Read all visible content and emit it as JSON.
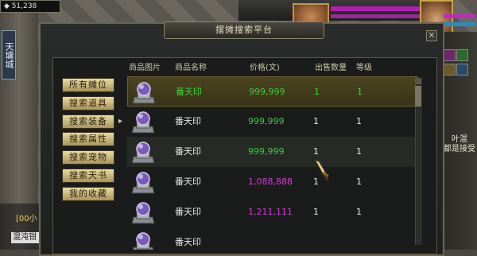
{
  "hud": {
    "gold": "51,238",
    "city": "天墉城"
  },
  "dialog": {
    "title": "摆摊搜索平台",
    "close": "×"
  },
  "side_buttons": [
    {
      "label": "所有摊位"
    },
    {
      "label": "搜索道具"
    },
    {
      "label": "搜索装备"
    },
    {
      "label": "搜索属性"
    },
    {
      "label": "搜索宠物"
    },
    {
      "label": "搜索天书"
    },
    {
      "label": "我的收藏"
    }
  ],
  "side_arrow": "▸",
  "table": {
    "columns": [
      "商品图片",
      "商品名称",
      "价格(文)",
      "出售数量",
      "等级"
    ],
    "rows": [
      {
        "name": "番天印",
        "price": "999,999",
        "qty": "1",
        "level": "1",
        "state": "selected"
      },
      {
        "name": "番天印",
        "price": "999,999",
        "qty": "1",
        "level": "1",
        "state": "normal"
      },
      {
        "name": "番天印",
        "price": "999,999",
        "qty": "1",
        "level": "1",
        "state": "alt"
      },
      {
        "name": "番天印",
        "price": "1,088,888",
        "qty": "1",
        "level": "1",
        "state": "normal"
      },
      {
        "name": "番天印",
        "price": "1,211,111",
        "qty": "1",
        "level": "1",
        "state": "normal"
      },
      {
        "name": "番天印",
        "price": "",
        "qty": "",
        "level": "",
        "state": "normal"
      }
    ]
  },
  "colors": {
    "selected_text": "#36d836",
    "normal_text": "#e8e8e8",
    "price_low": "#3ec83e",
    "price_high": "#d23ad2"
  },
  "side_text": {
    "right": "叶混\n都是接受",
    "chat_1": "[00小",
    "chat_2": "混沌钳"
  }
}
